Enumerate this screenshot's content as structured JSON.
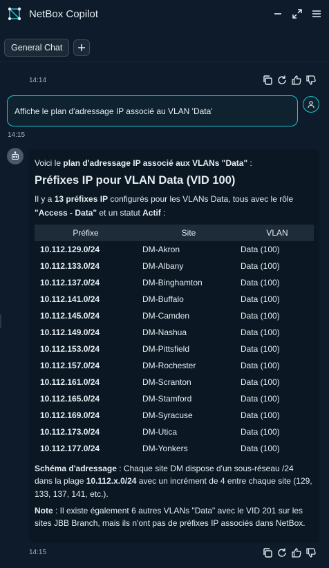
{
  "app": {
    "title": "NetBox Copilot"
  },
  "tabs": [
    {
      "label": "General Chat"
    }
  ],
  "previous_message": {
    "time": "14:14"
  },
  "user_message": {
    "text": "Affiche le plan d'adressage IP associé au VLAN 'Data'",
    "time": "14:15"
  },
  "assistant_message": {
    "intro": {
      "pre": "Voici le ",
      "bold": "plan d'adressage IP associé aux VLANs \"Data\"",
      "post": " :"
    },
    "heading": "Préfixes IP pour VLAN Data (VID 100)",
    "summary": {
      "t1": "Il y a ",
      "b1": "13 préfixes IP",
      "t2": " configurés pour les VLANs Data, tous avec le rôle",
      "b2": "\"Access - Data\"",
      "t3": " et un statut ",
      "b3": "Actif",
      "t4": " :"
    },
    "table": {
      "headers": [
        "Préfixe",
        "Site",
        "VLAN"
      ],
      "rows": [
        [
          "10.112.129.0/24",
          "DM-Akron",
          "Data (100)"
        ],
        [
          "10.112.133.0/24",
          "DM-Albany",
          "Data (100)"
        ],
        [
          "10.112.137.0/24",
          "DM-Binghamton",
          "Data (100)"
        ],
        [
          "10.112.141.0/24",
          "DM-Buffalo",
          "Data (100)"
        ],
        [
          "10.112.145.0/24",
          "DM-Camden",
          "Data (100)"
        ],
        [
          "10.112.149.0/24",
          "DM-Nashua",
          "Data (100)"
        ],
        [
          "10.112.153.0/24",
          "DM-Pittsfield",
          "Data (100)"
        ],
        [
          "10.112.157.0/24",
          "DM-Rochester",
          "Data (100)"
        ],
        [
          "10.112.161.0/24",
          "DM-Scranton",
          "Data (100)"
        ],
        [
          "10.112.165.0/24",
          "DM-Stamford",
          "Data (100)"
        ],
        [
          "10.112.169.0/24",
          "DM-Syracuse",
          "Data (100)"
        ],
        [
          "10.112.173.0/24",
          "DM-Utica",
          "Data (100)"
        ],
        [
          "10.112.177.0/24",
          "DM-Yonkers",
          "Data (100)"
        ]
      ]
    },
    "schema": {
      "label": "Schéma d'adressage",
      "t1": " : Chaque site DM dispose d'un sous-réseau /24 dans la plage ",
      "range": "10.112.x.0/24",
      "t2": " avec un incrément de 4 entre chaque site (129, 133, 137, 141, etc.)."
    },
    "note": {
      "label": "Note",
      "text": " : Il existe également 6 autres VLANs \"Data\" avec le VID 201 sur les sites JBB Branch, mais ils n'ont pas de préfixes IP associés dans NetBox."
    },
    "time": "14:15"
  },
  "colors": {
    "background": "#0d1b2a",
    "accent": "#1fc8d0",
    "panel": "#0b1722",
    "table_header": "#1e2c3a"
  },
  "icons": [
    "netbox-logo-icon",
    "minimize-icon",
    "expand-icon",
    "menu-icon",
    "plus-icon",
    "copy-icon",
    "regenerate-icon",
    "thumbs-up-icon",
    "thumbs-down-icon",
    "user-icon",
    "bot-icon"
  ]
}
